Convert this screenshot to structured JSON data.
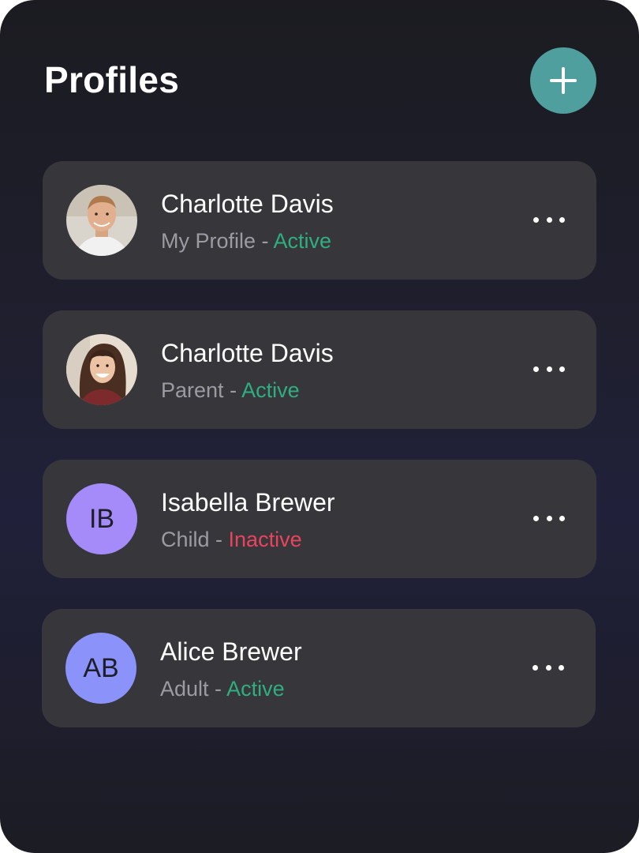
{
  "header": {
    "title": "Profiles",
    "add_icon": "plus-icon",
    "add_color": "#4f9f9f"
  },
  "profiles": [
    {
      "name": "Charlotte Davis",
      "role": "My Profile",
      "separator": " - ",
      "status": "Active",
      "avatar_type": "photo-man"
    },
    {
      "name": "Charlotte Davis",
      "role": "Parent",
      "separator": " - ",
      "status": "Active",
      "avatar_type": "photo-woman"
    },
    {
      "name": "Isabella Brewer",
      "role": "Child",
      "separator": " - ",
      "status": "Inactive",
      "initials": "IB",
      "avatar_color": "#a58bfa"
    },
    {
      "name": "Alice Brewer",
      "role": "Adult",
      "separator": " - ",
      "status": "Active",
      "initials": "AB",
      "avatar_color": "#8b93fb"
    }
  ],
  "colors": {
    "active": "#2fae80",
    "inactive": "#e8445e",
    "card": "#37373b",
    "subtext": "#9b9ba3"
  }
}
